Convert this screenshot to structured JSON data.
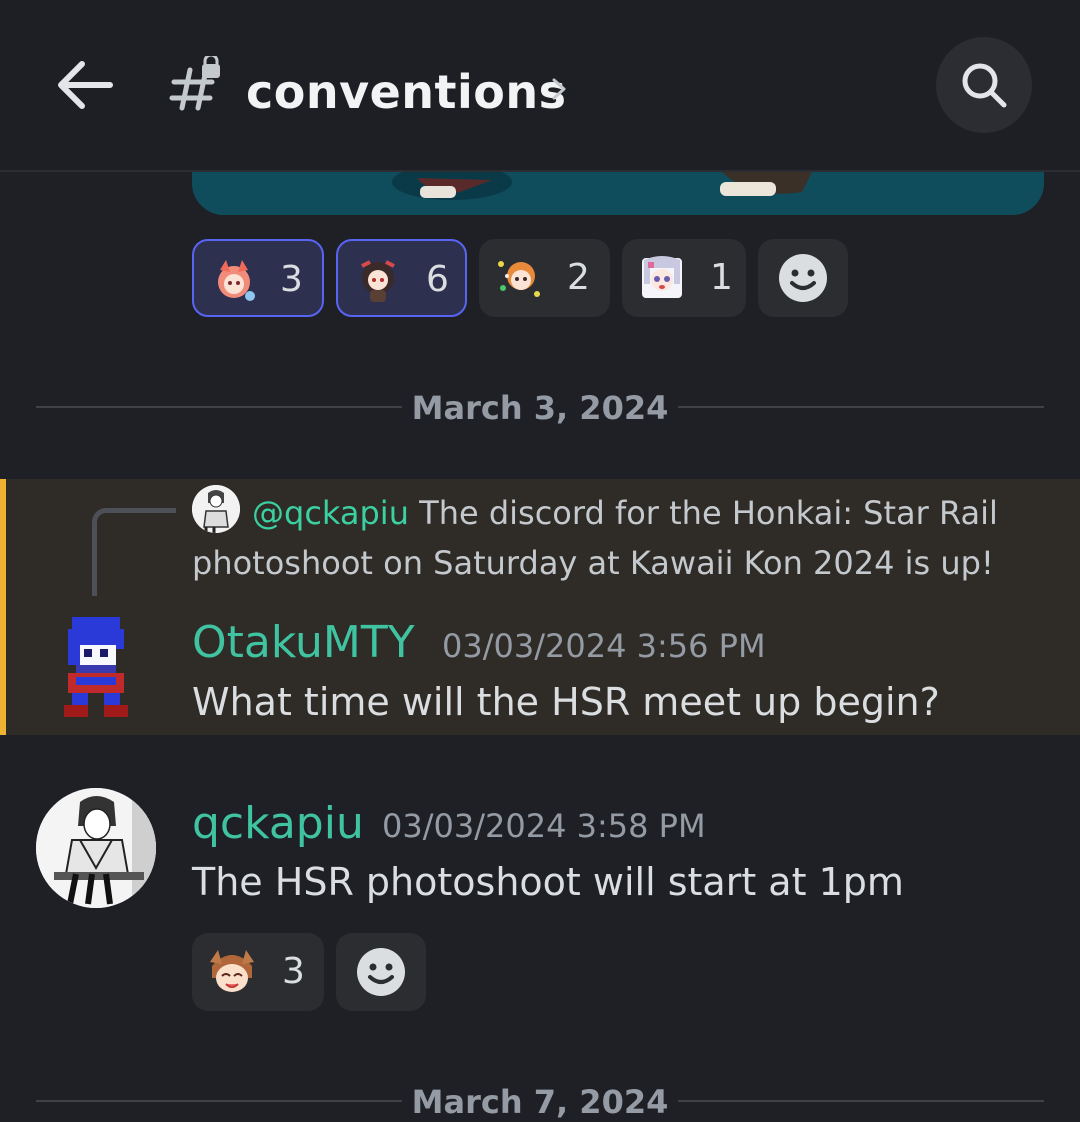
{
  "header": {
    "channel_name": "conventions"
  },
  "reactions_top": [
    {
      "emoji": "pink-haired-fox-girl-emoji",
      "count": "3",
      "selected": true
    },
    {
      "emoji": "dark-haired-girl-emoji",
      "count": "6",
      "selected": true
    },
    {
      "emoji": "orange-haired-boy-emoji",
      "count": "2",
      "selected": false
    },
    {
      "emoji": "white-haired-girl-emoji",
      "count": "1",
      "selected": false
    }
  ],
  "dividers": {
    "first": "March 3, 2024",
    "second": "March 7, 2024"
  },
  "reply_message": {
    "reply": {
      "mention": "@qckapiu",
      "text": "The discord for the Honkai: Star Rail photoshoot on Saturday at Kawaii Kon 2024 is up!"
    },
    "username": "OtakuMTY",
    "timestamp": "03/03/2024 3:56 PM",
    "content": "What time will the HSR meet up begin?"
  },
  "message2": {
    "username": "qckapiu",
    "timestamp": "03/03/2024 3:58 PM",
    "content": "The HSR photoshoot will start at 1pm",
    "reactions": [
      {
        "emoji": "brown-haired-character-emoji",
        "count": "3",
        "selected": false
      }
    ]
  },
  "colors": {
    "background": "#1f2025",
    "username": "#3fc3a0",
    "mention_highlight": "#2f2b26",
    "mention_bar": "#f0b232",
    "reaction_selected_border": "#5865f2"
  }
}
